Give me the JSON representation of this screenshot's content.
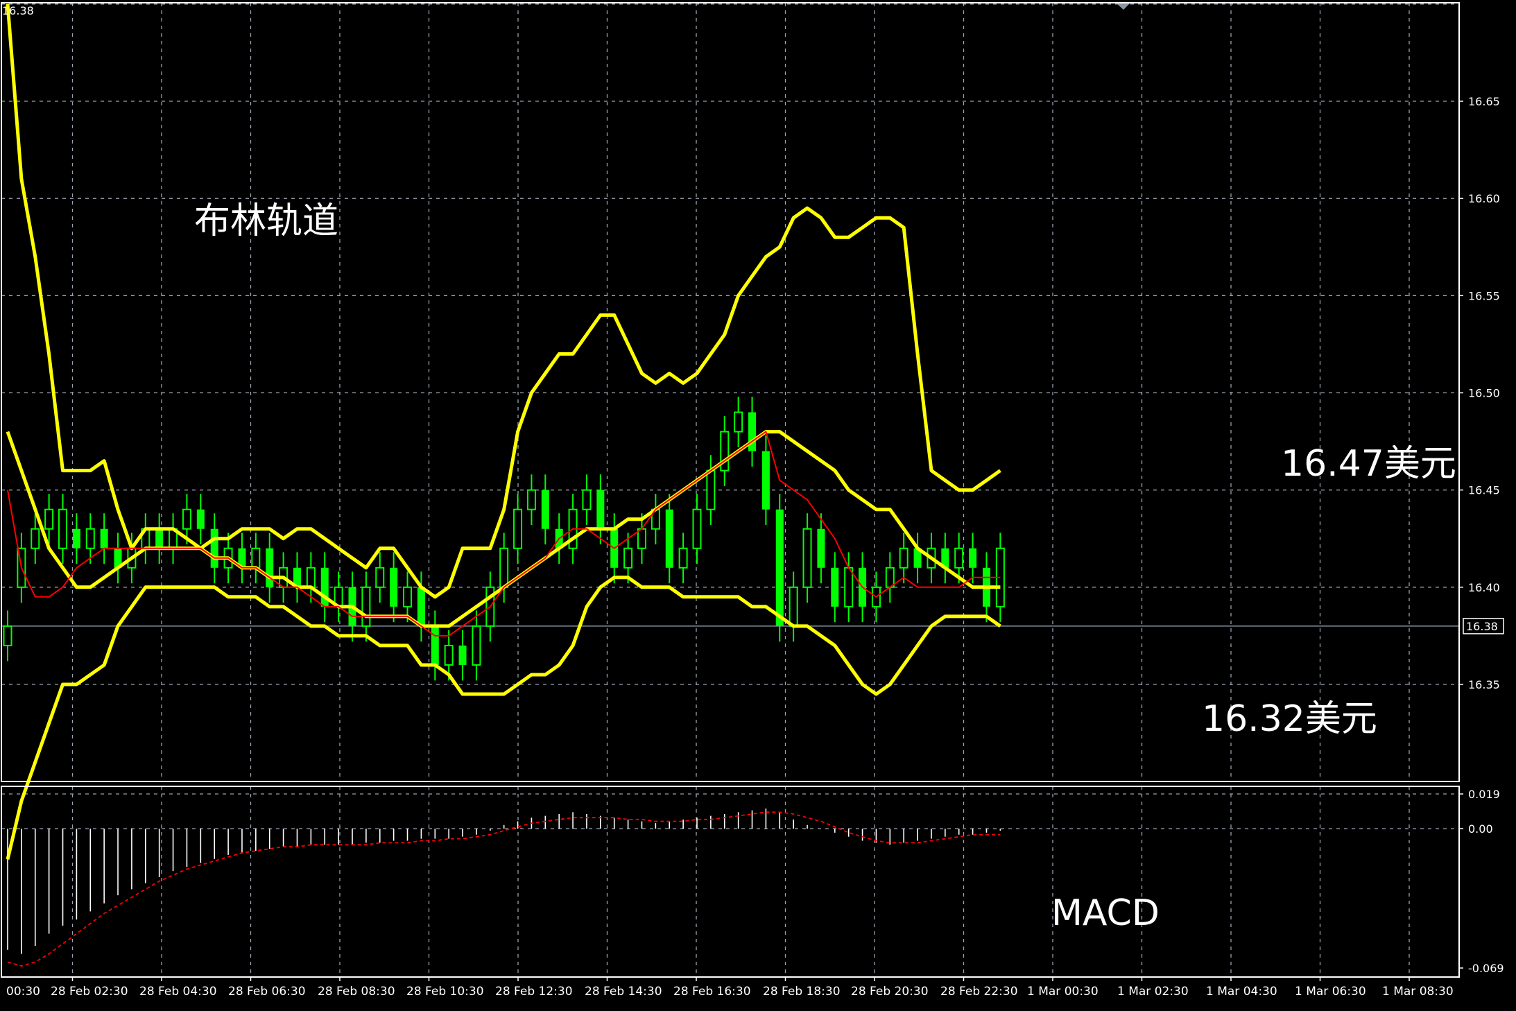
{
  "colors": {
    "background": "#000000",
    "candle": "#00ff00",
    "band": "#ffff00",
    "ma": "#ff0000",
    "histogram": "#ffffff",
    "signal": "#ff0000",
    "grid": "#9aa4b0",
    "axis": "#ffffff",
    "current_price_line": "#7f8ea0"
  },
  "chart_data": [
    {
      "type": "line",
      "name": "price-panel",
      "grid": true,
      "ylim": [
        16.3,
        16.7
      ],
      "yticks": [
        16.35,
        16.4,
        16.45,
        16.5,
        16.55,
        16.6,
        16.65
      ],
      "ytick_labels": [
        "16.35",
        "16.40",
        "16.45",
        "16.50",
        "16.55",
        "16.60",
        "16.65"
      ],
      "top_left_label": "16.38",
      "current_price": 16.38,
      "current_price_label": "16.38",
      "upper_band": [
        16.7,
        16.61,
        16.57,
        16.52,
        16.46,
        16.46,
        16.46,
        16.465,
        16.44,
        16.42,
        16.43,
        16.43,
        16.43,
        16.425,
        16.42,
        16.425,
        16.425,
        16.43,
        16.43,
        16.43,
        16.425,
        16.43,
        16.43,
        16.425,
        16.42,
        16.415,
        16.41,
        16.42,
        16.42,
        16.41,
        16.4,
        16.395,
        16.4,
        16.42,
        16.42,
        16.42,
        16.44,
        16.48,
        16.5,
        16.51,
        16.52,
        16.52,
        16.53,
        16.54,
        16.54,
        16.525,
        16.51,
        16.505,
        16.51,
        16.505,
        16.51,
        16.52,
        16.53,
        16.55,
        16.56,
        16.57,
        16.575,
        16.59,
        16.595,
        16.59,
        16.58,
        16.58,
        16.585,
        16.59,
        16.59,
        16.585,
        16.52,
        16.46,
        16.455,
        16.45,
        16.45,
        16.455,
        16.46
      ],
      "middle_band": [
        16.48,
        16.46,
        16.44,
        16.42,
        16.41,
        16.4,
        16.4,
        16.405,
        16.41,
        16.415,
        16.42,
        16.42,
        16.42,
        16.42,
        16.42,
        16.415,
        16.415,
        16.41,
        16.41,
        16.405,
        16.405,
        16.4,
        16.4,
        16.395,
        16.39,
        16.39,
        16.385,
        16.385,
        16.385,
        16.385,
        16.38,
        16.38,
        16.38,
        16.385,
        16.39,
        16.395,
        16.4,
        16.405,
        16.41,
        16.415,
        16.42,
        16.425,
        16.43,
        16.43,
        16.43,
        16.435,
        16.435,
        16.44,
        16.445,
        16.45,
        16.455,
        16.46,
        16.465,
        16.47,
        16.475,
        16.48,
        16.48,
        16.475,
        16.47,
        16.465,
        16.46,
        16.45,
        16.445,
        16.44,
        16.44,
        16.43,
        16.42,
        16.415,
        16.41,
        16.405,
        16.4,
        16.4,
        16.4
      ],
      "lower_band": [
        16.26,
        16.29,
        16.31,
        16.33,
        16.35,
        16.35,
        16.355,
        16.36,
        16.38,
        16.39,
        16.4,
        16.4,
        16.4,
        16.4,
        16.4,
        16.4,
        16.395,
        16.395,
        16.395,
        16.39,
        16.39,
        16.385,
        16.38,
        16.38,
        16.375,
        16.375,
        16.375,
        16.37,
        16.37,
        16.37,
        16.36,
        16.36,
        16.355,
        16.345,
        16.345,
        16.345,
        16.345,
        16.35,
        16.355,
        16.355,
        16.36,
        16.37,
        16.39,
        16.4,
        16.405,
        16.405,
        16.4,
        16.4,
        16.4,
        16.395,
        16.395,
        16.395,
        16.395,
        16.395,
        16.39,
        16.39,
        16.385,
        16.38,
        16.38,
        16.375,
        16.37,
        16.36,
        16.35,
        16.345,
        16.35,
        16.36,
        16.37,
        16.38,
        16.385,
        16.385,
        16.385,
        16.385,
        16.38
      ],
      "ma": [
        16.45,
        16.41,
        16.395,
        16.395,
        16.4,
        16.41,
        16.415,
        16.42,
        16.42,
        16.42,
        16.42,
        16.42,
        16.42,
        16.42,
        16.42,
        16.415,
        16.415,
        16.41,
        16.41,
        16.405,
        16.4,
        16.4,
        16.395,
        16.39,
        16.39,
        16.385,
        16.385,
        16.385,
        16.385,
        16.385,
        16.38,
        16.375,
        16.375,
        16.38,
        16.385,
        16.39,
        16.4,
        16.405,
        16.41,
        16.415,
        16.425,
        16.43,
        16.43,
        16.425,
        16.42,
        16.425,
        16.43,
        16.44,
        16.445,
        16.45,
        16.455,
        16.46,
        16.465,
        16.47,
        16.475,
        16.48,
        16.455,
        16.45,
        16.445,
        16.435,
        16.425,
        16.41,
        16.4,
        16.395,
        16.4,
        16.405,
        16.4,
        16.4,
        16.4,
        16.4,
        16.405,
        16.405,
        16.405
      ],
      "candles": [
        [
          16.37,
          16.38
        ],
        [
          16.4,
          16.42
        ],
        [
          16.42,
          16.43
        ],
        [
          16.43,
          16.44
        ],
        [
          16.42,
          16.44
        ],
        [
          16.43,
          16.42
        ],
        [
          16.42,
          16.43
        ],
        [
          16.43,
          16.42
        ],
        [
          16.42,
          16.41
        ],
        [
          16.41,
          16.42
        ],
        [
          16.42,
          16.43
        ],
        [
          16.43,
          16.42
        ],
        [
          16.42,
          16.43
        ],
        [
          16.43,
          16.44
        ],
        [
          16.44,
          16.43
        ],
        [
          16.43,
          16.41
        ],
        [
          16.41,
          16.42
        ],
        [
          16.42,
          16.41
        ],
        [
          16.41,
          16.42
        ],
        [
          16.42,
          16.4
        ],
        [
          16.4,
          16.41
        ],
        [
          16.41,
          16.4
        ],
        [
          16.4,
          16.41
        ],
        [
          16.41,
          16.39
        ],
        [
          16.39,
          16.4
        ],
        [
          16.4,
          16.38
        ],
        [
          16.38,
          16.4
        ],
        [
          16.4,
          16.41
        ],
        [
          16.41,
          16.39
        ],
        [
          16.39,
          16.4
        ],
        [
          16.4,
          16.38
        ],
        [
          16.38,
          16.36
        ],
        [
          16.36,
          16.37
        ],
        [
          16.37,
          16.36
        ],
        [
          16.36,
          16.38
        ],
        [
          16.38,
          16.4
        ],
        [
          16.4,
          16.42
        ],
        [
          16.42,
          16.44
        ],
        [
          16.44,
          16.45
        ],
        [
          16.45,
          16.43
        ],
        [
          16.43,
          16.42
        ],
        [
          16.42,
          16.44
        ],
        [
          16.44,
          16.45
        ],
        [
          16.45,
          16.43
        ],
        [
          16.43,
          16.41
        ],
        [
          16.41,
          16.42
        ],
        [
          16.42,
          16.43
        ],
        [
          16.43,
          16.44
        ],
        [
          16.44,
          16.41
        ],
        [
          16.41,
          16.42
        ],
        [
          16.42,
          16.44
        ],
        [
          16.44,
          16.46
        ],
        [
          16.46,
          16.48
        ],
        [
          16.48,
          16.49
        ],
        [
          16.49,
          16.47
        ],
        [
          16.47,
          16.44
        ],
        [
          16.44,
          16.38
        ],
        [
          16.38,
          16.4
        ],
        [
          16.4,
          16.43
        ],
        [
          16.43,
          16.41
        ],
        [
          16.41,
          16.39
        ],
        [
          16.39,
          16.41
        ],
        [
          16.41,
          16.39
        ],
        [
          16.39,
          16.4
        ],
        [
          16.4,
          16.41
        ],
        [
          16.41,
          16.42
        ],
        [
          16.42,
          16.41
        ],
        [
          16.41,
          16.42
        ],
        [
          16.42,
          16.41
        ],
        [
          16.41,
          16.42
        ],
        [
          16.42,
          16.41
        ],
        [
          16.41,
          16.39
        ],
        [
          16.39,
          16.42
        ]
      ]
    },
    {
      "type": "bar",
      "name": "macd-panel",
      "label": "MACD",
      "ylim": [
        -0.069,
        0.019
      ],
      "yticks": [
        0.019,
        0.0,
        -0.069
      ],
      "ytick_labels": [
        "0.019",
        "0.00",
        "-0.069"
      ],
      "histogram": [
        -0.06,
        -0.062,
        -0.058,
        -0.052,
        -0.048,
        -0.045,
        -0.041,
        -0.037,
        -0.033,
        -0.03,
        -0.027,
        -0.024,
        -0.021,
        -0.019,
        -0.017,
        -0.015,
        -0.013,
        -0.012,
        -0.011,
        -0.01,
        -0.009,
        -0.009,
        -0.008,
        -0.008,
        -0.008,
        -0.008,
        -0.007,
        -0.007,
        -0.006,
        -0.006,
        -0.005,
        -0.005,
        -0.005,
        -0.004,
        -0.003,
        -0.001,
        0.002,
        0.004,
        0.006,
        0.007,
        0.008,
        0.009,
        0.008,
        0.007,
        0.006,
        0.005,
        0.004,
        0.003,
        0.004,
        0.005,
        0.006,
        0.007,
        0.008,
        0.009,
        0.01,
        0.011,
        0.009,
        0.005,
        0.002,
        0.0,
        -0.002,
        -0.004,
        -0.006,
        -0.007,
        -0.008,
        -0.007,
        -0.006,
        -0.005,
        -0.004,
        -0.003,
        -0.003,
        -0.002,
        -0.001
      ],
      "signal": [
        -0.066,
        -0.068,
        -0.066,
        -0.062,
        -0.057,
        -0.052,
        -0.047,
        -0.042,
        -0.038,
        -0.034,
        -0.03,
        -0.026,
        -0.023,
        -0.02,
        -0.018,
        -0.016,
        -0.014,
        -0.012,
        -0.011,
        -0.01,
        -0.009,
        -0.009,
        -0.008,
        -0.008,
        -0.008,
        -0.008,
        -0.008,
        -0.007,
        -0.007,
        -0.007,
        -0.006,
        -0.006,
        -0.005,
        -0.005,
        -0.004,
        -0.003,
        -0.001,
        0.001,
        0.003,
        0.004,
        0.005,
        0.006,
        0.006,
        0.006,
        0.006,
        0.005,
        0.005,
        0.004,
        0.004,
        0.004,
        0.005,
        0.005,
        0.006,
        0.007,
        0.008,
        0.009,
        0.009,
        0.008,
        0.006,
        0.004,
        0.001,
        -0.002,
        -0.004,
        -0.006,
        -0.007,
        -0.007,
        -0.007,
        -0.006,
        -0.005,
        -0.004,
        -0.003,
        -0.003,
        -0.003
      ]
    }
  ],
  "x_axis": {
    "tick_labels": [
      "00:30",
      "28 Feb 02:30",
      "28 Feb 04:30",
      "28 Feb 06:30",
      "28 Feb 08:30",
      "28 Feb 10:30",
      "28 Feb 12:30",
      "28 Feb 14:30",
      "28 Feb 16:30",
      "28 Feb 18:30",
      "28 Feb 20:30",
      "28 Feb 22:30",
      "1 Mar 00:30",
      "1 Mar 02:30",
      "1 Mar 04:30",
      "1 Mar 06:30",
      "1 Mar 08:30"
    ]
  },
  "annotations": {
    "bollinger": "布林轨道",
    "upper_price": "16.47美元",
    "lower_price": "16.32美元",
    "macd": "MACD"
  }
}
